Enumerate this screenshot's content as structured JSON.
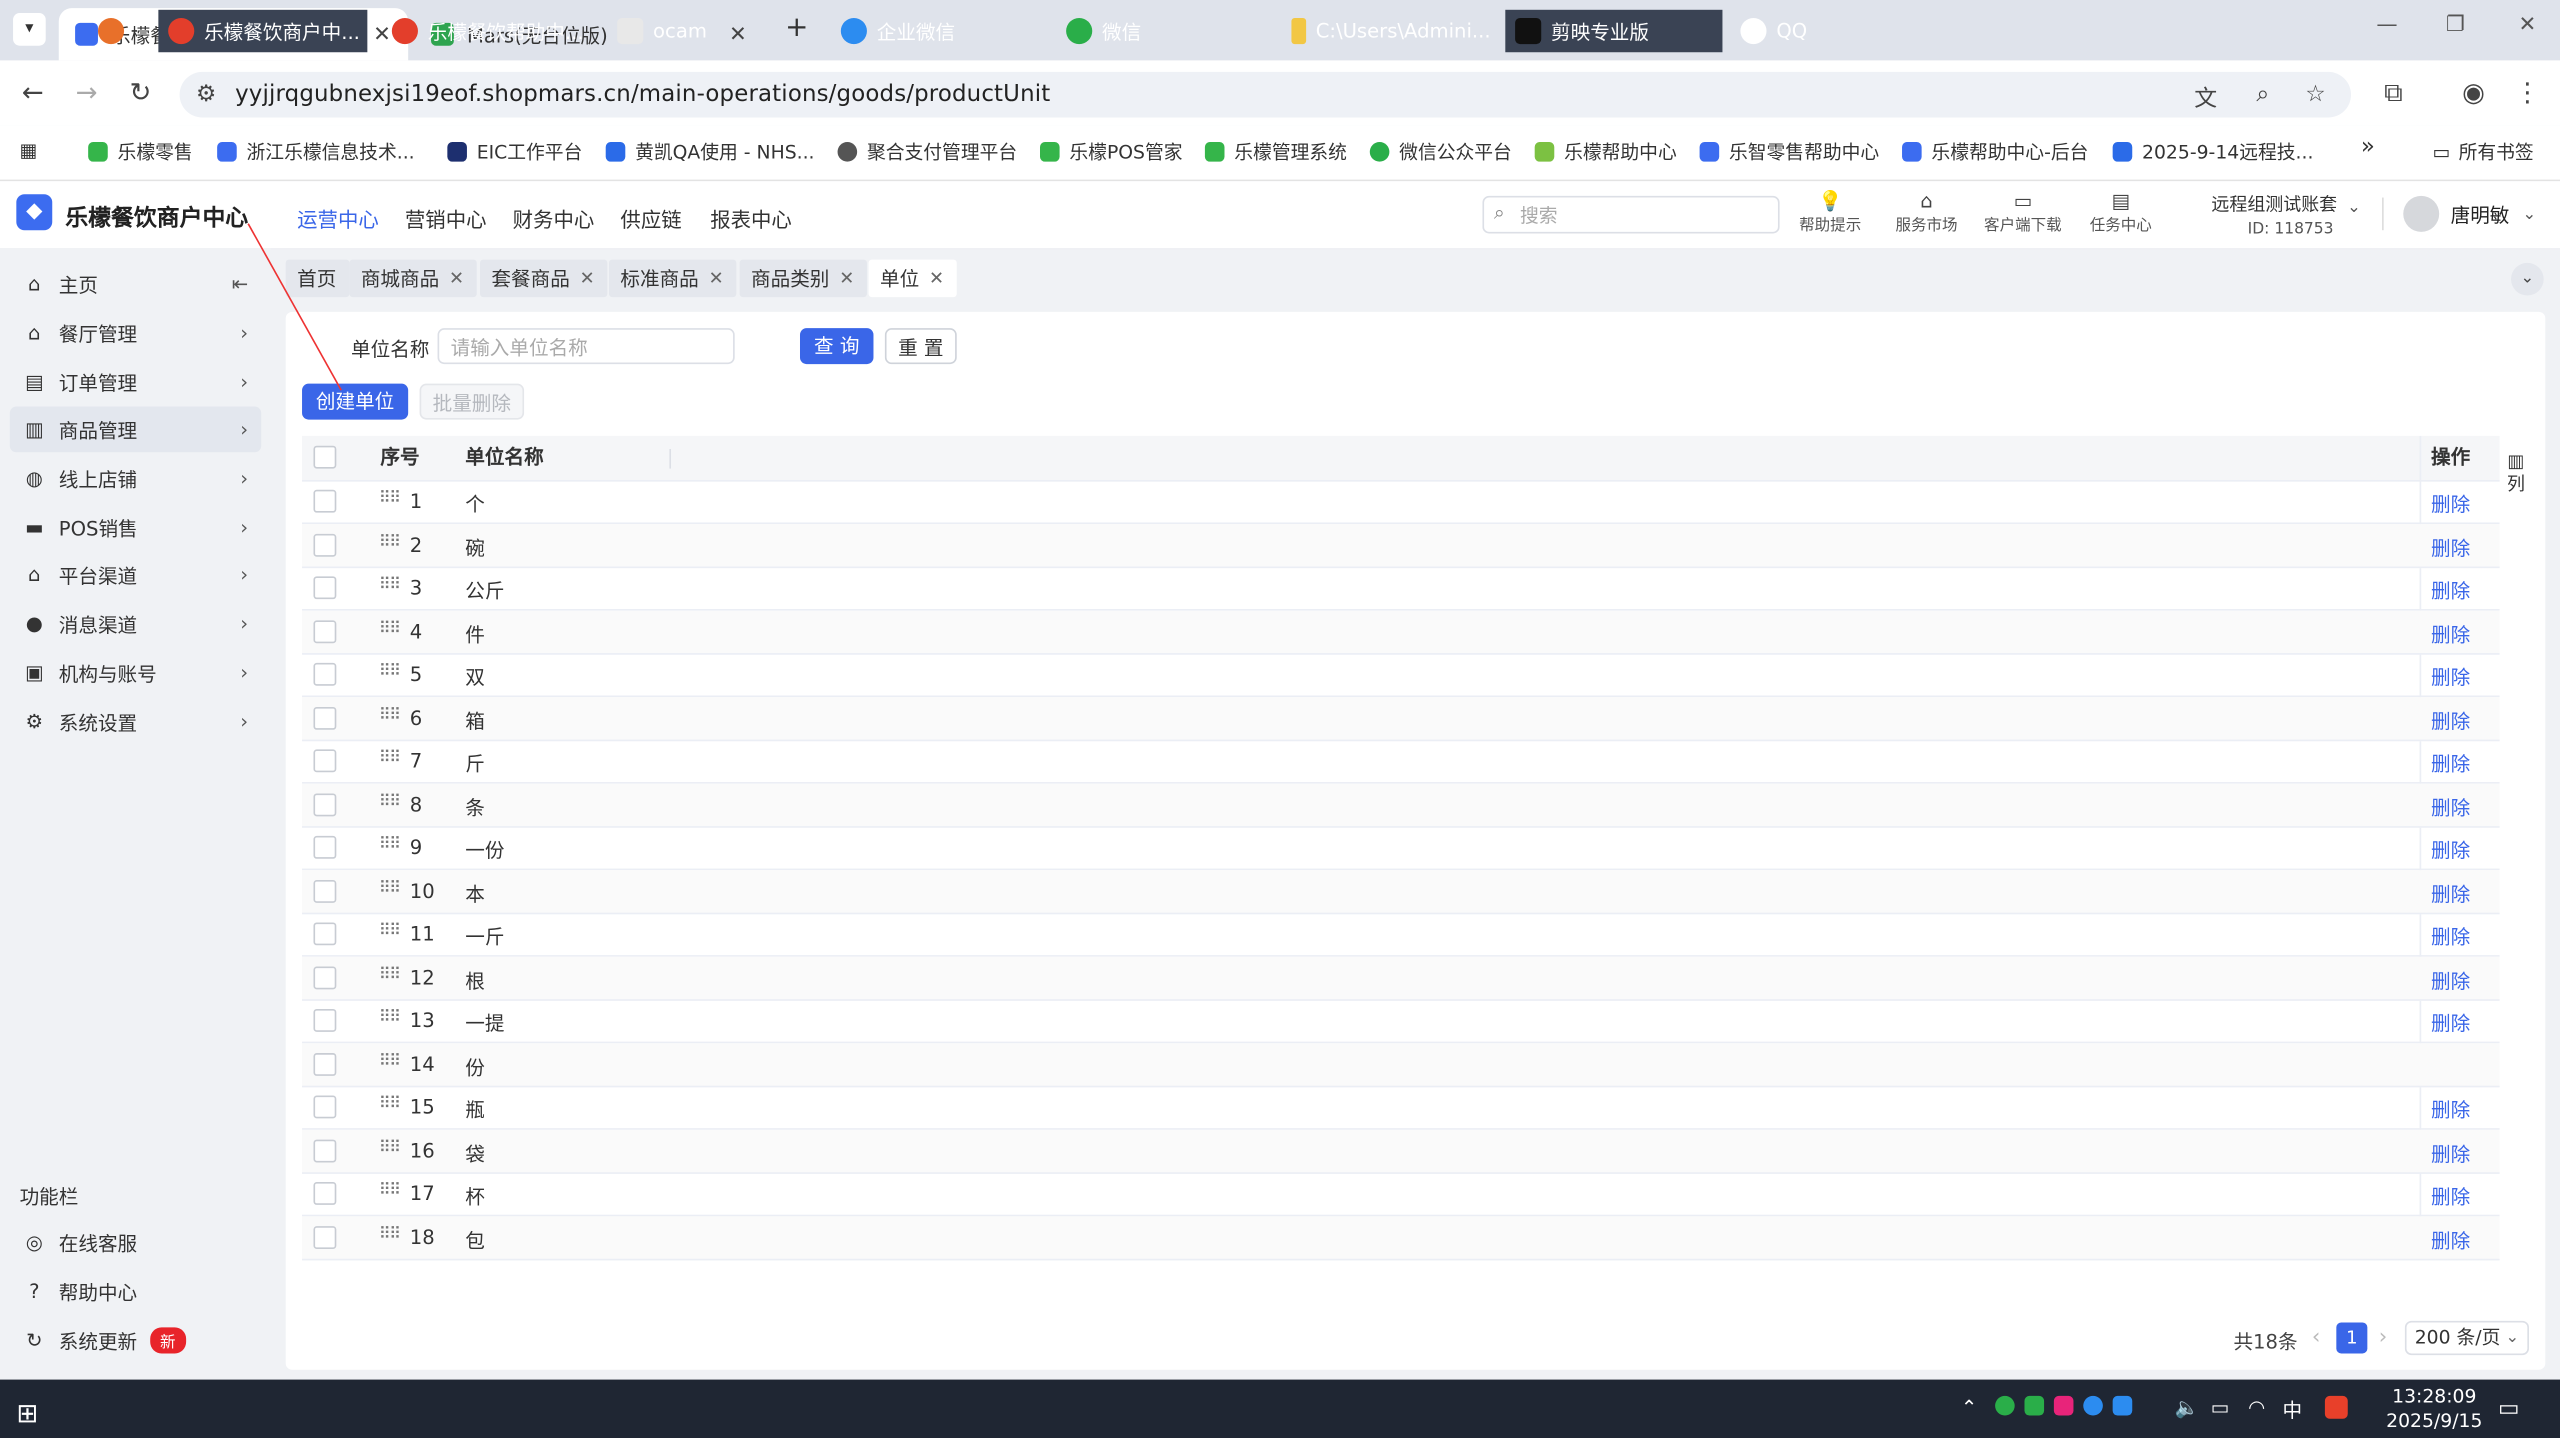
{
  "browser": {
    "tabs": [
      {
        "title": "乐檬餐饮商户中心",
        "active": true
      },
      {
        "title": "Mars(无台位版)",
        "active": false
      }
    ],
    "new_tab": "+",
    "window_controls": [
      "—",
      "❐",
      "✕"
    ],
    "url": "yyjjrqgubnexjsi19eof.shopmars.cn/main-operations/goods/productUnit",
    "bookmarks": [
      "乐檬零售",
      "浙江乐檬信息技术...",
      "EIC工作平台",
      "黄凯QA使用 - NHS...",
      "聚合支付管理平台",
      "乐檬POS管家",
      "乐檬管理系统",
      "微信公众平台",
      "乐檬帮助中心",
      "乐智零售帮助中心",
      "乐檬帮助中心-后台",
      "2025-9-14远程技..."
    ],
    "more_bookmarks": "»",
    "all_bookmarks": "所有书签"
  },
  "app": {
    "brand": "乐檬餐饮商户中心",
    "top_nav": [
      "运营中心",
      "营销中心",
      "财务中心",
      "供应链",
      "报表中心"
    ],
    "search_placeholder": "搜索",
    "header_icons": [
      {
        "label": "帮助提示",
        "icon": "bulb-icon"
      },
      {
        "label": "服务市场",
        "icon": "store-icon"
      },
      {
        "label": "客户端下载",
        "icon": "folder-icon"
      },
      {
        "label": "任务中心",
        "icon": "clipboard-icon"
      }
    ],
    "account": {
      "name": "远程组测试账套",
      "id": "ID: 118753"
    },
    "user": "唐明敏"
  },
  "sidebar": {
    "items": [
      "主页",
      "餐厅管理",
      "订单管理",
      "商品管理",
      "线上店铺",
      "POS销售",
      "平台渠道",
      "消息渠道",
      "机构与账号",
      "系统设置"
    ],
    "active": "商品管理",
    "func_title": "功能栏",
    "func_items": [
      "在线客服",
      "帮助中心",
      "系统更新"
    ],
    "new_badge": "新"
  },
  "page_tabs": [
    "首页",
    "商城商品",
    "套餐商品",
    "标准商品",
    "商品类别",
    "单位"
  ],
  "filter": {
    "label": "单位名称",
    "placeholder": "请输入单位名称",
    "query_btn": "查 询",
    "reset_btn": "重 置"
  },
  "actions": {
    "create": "创建单位",
    "batch_delete": "批量删除"
  },
  "table": {
    "columns": [
      "序号",
      "单位名称",
      "操作"
    ],
    "col_setting": "列",
    "delete_label": "删除",
    "rows": [
      {
        "no": "1",
        "name": "个",
        "deletable": true
      },
      {
        "no": "2",
        "name": "碗",
        "deletable": true
      },
      {
        "no": "3",
        "name": "公斤",
        "deletable": true
      },
      {
        "no": "4",
        "name": "件",
        "deletable": true
      },
      {
        "no": "5",
        "name": "双",
        "deletable": true
      },
      {
        "no": "6",
        "name": "箱",
        "deletable": true
      },
      {
        "no": "7",
        "name": "斤",
        "deletable": true
      },
      {
        "no": "8",
        "name": "条",
        "deletable": true
      },
      {
        "no": "9",
        "name": "一份",
        "deletable": true
      },
      {
        "no": "10",
        "name": "本",
        "deletable": true
      },
      {
        "no": "11",
        "name": "一斤",
        "deletable": true
      },
      {
        "no": "12",
        "name": "根",
        "deletable": true
      },
      {
        "no": "13",
        "name": "一提",
        "deletable": true
      },
      {
        "no": "14",
        "name": "份",
        "deletable": false
      },
      {
        "no": "15",
        "name": "瓶",
        "deletable": true
      },
      {
        "no": "16",
        "name": "袋",
        "deletable": true
      },
      {
        "no": "17",
        "name": "杯",
        "deletable": true
      },
      {
        "no": "18",
        "name": "包",
        "deletable": true
      }
    ]
  },
  "pagination": {
    "total": "共18条",
    "current": "1",
    "page_size": "200 条/页"
  },
  "taskbar": {
    "apps": [
      "乐檬餐饮商户中...",
      "乐檬餐饮帮助中...",
      "ocam",
      "企业微信",
      "微信",
      "C:\\Users\\Admini...",
      "剪映专业版",
      "QQ"
    ],
    "ime": "中",
    "time": "13:28:09",
    "date": "2025/9/15"
  },
  "colors": {
    "accent": "#3a66e8",
    "badge": "#e8242a",
    "taskbar": "#1f2633"
  }
}
